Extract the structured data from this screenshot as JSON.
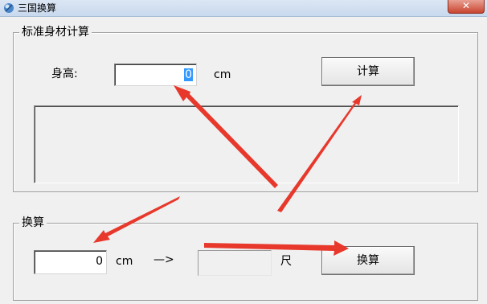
{
  "window": {
    "title": "三国换算",
    "close_glyph": "✕"
  },
  "standard_calc": {
    "group_title": "标准身材计算",
    "height_label": "身高:",
    "height_value": "0",
    "unit": "cm",
    "calc_button": "计算"
  },
  "convert": {
    "group_title": "换算",
    "input_value": "0",
    "unit": "cm",
    "arrow_text": "—>",
    "result_value": "",
    "result_unit": "尺",
    "convert_button": "换算"
  },
  "colors": {
    "annotation_arrow": "#e8382c"
  }
}
